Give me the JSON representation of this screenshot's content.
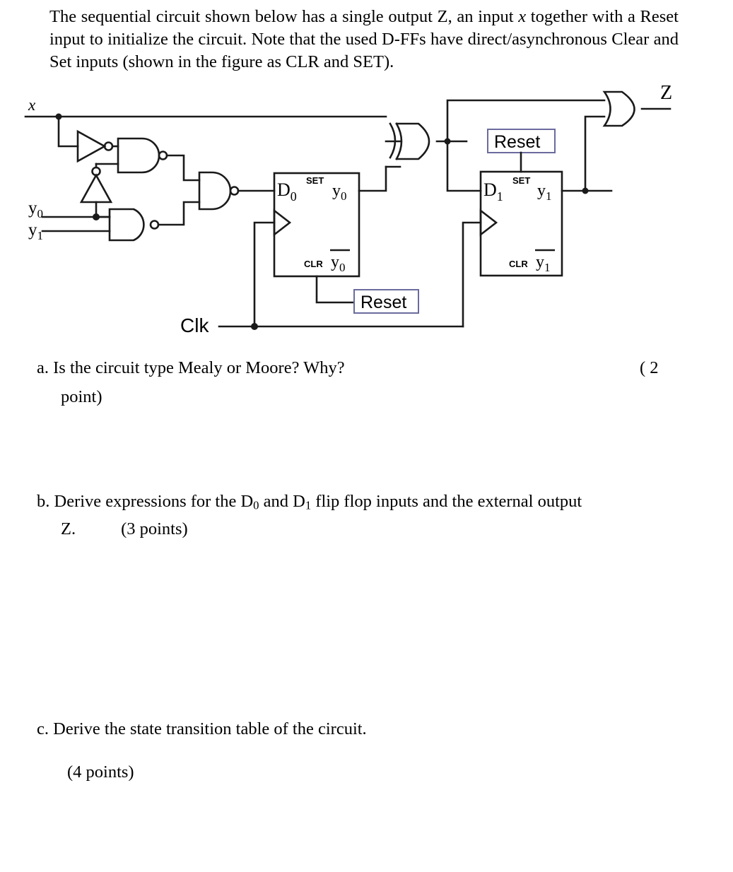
{
  "intro": {
    "line1_a": "The sequential circuit shown below has a single output Z, an input ",
    "line1_x": "x",
    "line1_b": " together",
    "line2": "with a Reset input to initialize the circuit. Note that the used D-FFs have",
    "line3": "direct/asynchronous Clear and Set inputs (shown in the figure as CLR and SET)."
  },
  "figure": {
    "input_x": "x",
    "input_y0": "y",
    "input_y0_sub": "0",
    "input_y1": "y",
    "input_y1_sub": "1",
    "clk_label": "Clk",
    "output_z": "Z",
    "ff0": {
      "d_label": "D",
      "d_sub": "0",
      "set_label": "SET",
      "clr_label": "CLR",
      "q_label": "y",
      "q_sub": "0",
      "qbar_label": "y",
      "qbar_sub": "0"
    },
    "ff1": {
      "d_label": "D",
      "d_sub": "1",
      "set_label": "SET",
      "clr_label": "CLR",
      "q_label": "y",
      "q_sub": "1",
      "qbar_label": "y",
      "qbar_sub": "1"
    },
    "reset_ff0_label": "Reset",
    "reset_ff1_label": "Reset",
    "colors": {
      "wire": "#1a1a1a",
      "reset_box_border": "#6b6b9e",
      "text": "#000000"
    }
  },
  "questions": {
    "a_text": "a. Is the circuit type Mealy or Moore? Why?",
    "a_points": "( 2",
    "a_points_cont": "point)",
    "b_text_1": "b. Derive expressions for the D",
    "b_sub_0": "0",
    "b_text_2": " and D",
    "b_sub_1": "1",
    "b_text_3": " flip flop inputs and the external output",
    "b_text_z": "Z.",
    "b_points": "(3 points)",
    "c_text": "c. Derive the state transition table of the circuit.",
    "c_points": "(4 points)"
  }
}
